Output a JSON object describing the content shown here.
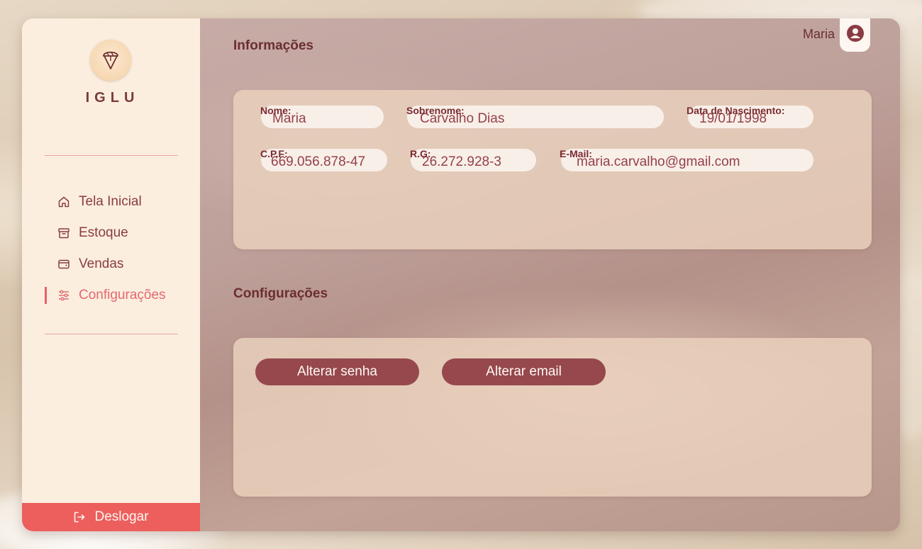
{
  "brand": {
    "name": "IGLU",
    "logo_icon": "ice-cream-icon"
  },
  "sidebar": {
    "items": [
      {
        "label": "Tela Inicial",
        "icon": "home-icon",
        "active": false
      },
      {
        "label": "Estoque",
        "icon": "archive-box-icon",
        "active": false
      },
      {
        "label": "Vendas",
        "icon": "wallet-icon",
        "active": false
      },
      {
        "label": "Configurações",
        "icon": "sliders-icon",
        "active": true
      }
    ],
    "logout": {
      "label": "Deslogar",
      "icon": "logout-icon"
    }
  },
  "header": {
    "user_name": "Maria",
    "avatar_icon": "user-avatar-icon"
  },
  "info_section": {
    "title": "Informações",
    "fields": {
      "first_name": {
        "label": "Nome:",
        "value": "Maria"
      },
      "last_name": {
        "label": "Sobrenome:",
        "value": "Carvalho Dias"
      },
      "birth_date": {
        "label": "Data de Nascimento:",
        "value": "19/01/1998"
      },
      "cpf": {
        "label": "C.P.F:",
        "value": "669.056.878-47"
      },
      "rg": {
        "label": "R.G:",
        "value": "26.272.928-3"
      },
      "email": {
        "label": "E-Mail:",
        "value": "maria.carvalho@gmail.com"
      }
    }
  },
  "settings_section": {
    "title": "Configurações",
    "buttons": {
      "change_password": "Alterar senha",
      "change_email": "Alterar email"
    }
  },
  "colors": {
    "accent": "#ec5f5d",
    "button": "#96484d",
    "text_dark": "#6b2e32",
    "sidebar_bg": "#fbeedf"
  }
}
